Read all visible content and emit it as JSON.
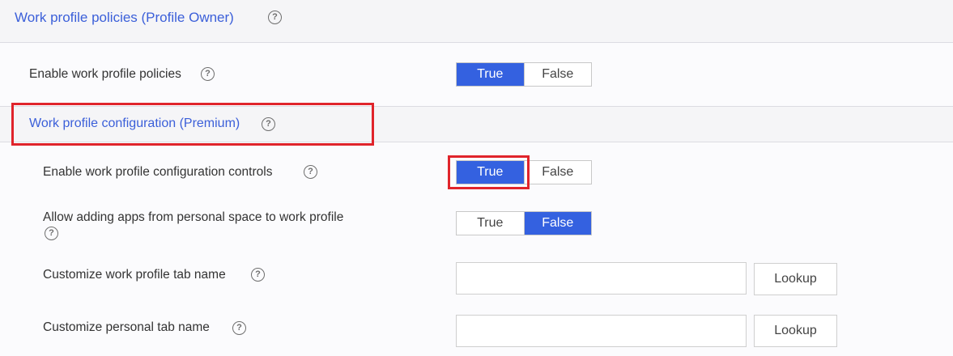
{
  "sections": {
    "profile_owner": {
      "title": "Work profile policies (Profile Owner)",
      "help_icon": "question-circle-icon"
    },
    "configuration": {
      "title": "Work profile configuration (Premium)",
      "help_icon": "question-circle-icon"
    }
  },
  "rows": {
    "enable_policies": {
      "label": "Enable work profile policies",
      "true_label": "True",
      "false_label": "False",
      "selected": "True"
    },
    "enable_config_controls": {
      "label": "Enable work profile configuration controls",
      "true_label": "True",
      "false_label": "False",
      "selected": "True"
    },
    "allow_adding_apps": {
      "label": "Allow adding apps from personal space to work profile",
      "true_label": "True",
      "false_label": "False",
      "selected": "False"
    },
    "work_tab_name": {
      "label": "Customize work profile tab name",
      "value": "",
      "lookup_label": "Lookup"
    },
    "personal_tab_name": {
      "label": "Customize personal tab name",
      "value": "",
      "lookup_label": "Lookup"
    }
  },
  "colors": {
    "accent": "#3461e0",
    "title_link": "#3b5fd9",
    "highlight": "#e0242b"
  }
}
